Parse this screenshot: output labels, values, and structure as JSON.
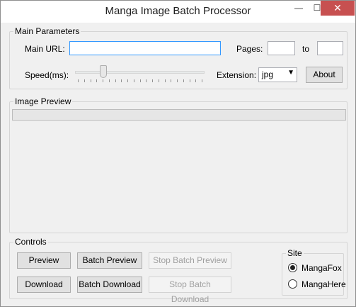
{
  "window": {
    "title": "Manga Image Batch Processor",
    "minimize": "—",
    "maximize": "☐",
    "close": "✕"
  },
  "main_parameters": {
    "group_label": "Main Parameters",
    "url_label": "Main URL:",
    "url_value": "",
    "pages_label": "Pages:",
    "pages_from": "",
    "to_label": "to",
    "pages_to": "",
    "speed_label": "Speed(ms):",
    "speed_level_fraction": 0.2,
    "extension_label": "Extension:",
    "extension_value": "jpg",
    "about_button": "About"
  },
  "image_preview": {
    "group_label": "Image Preview",
    "progress_fraction": 0
  },
  "controls": {
    "group_label": "Controls",
    "preview_button": "Preview",
    "batch_preview_button": "Batch Preview",
    "stop_batch_preview_button": "Stop Batch Preview",
    "download_button": "Download",
    "batch_download_button": "Batch Download",
    "stop_batch_download_button": "Stop Batch Download"
  },
  "site": {
    "group_label": "Site",
    "options": [
      "MangaFox",
      "MangaHere"
    ],
    "selected": "MangaFox"
  }
}
